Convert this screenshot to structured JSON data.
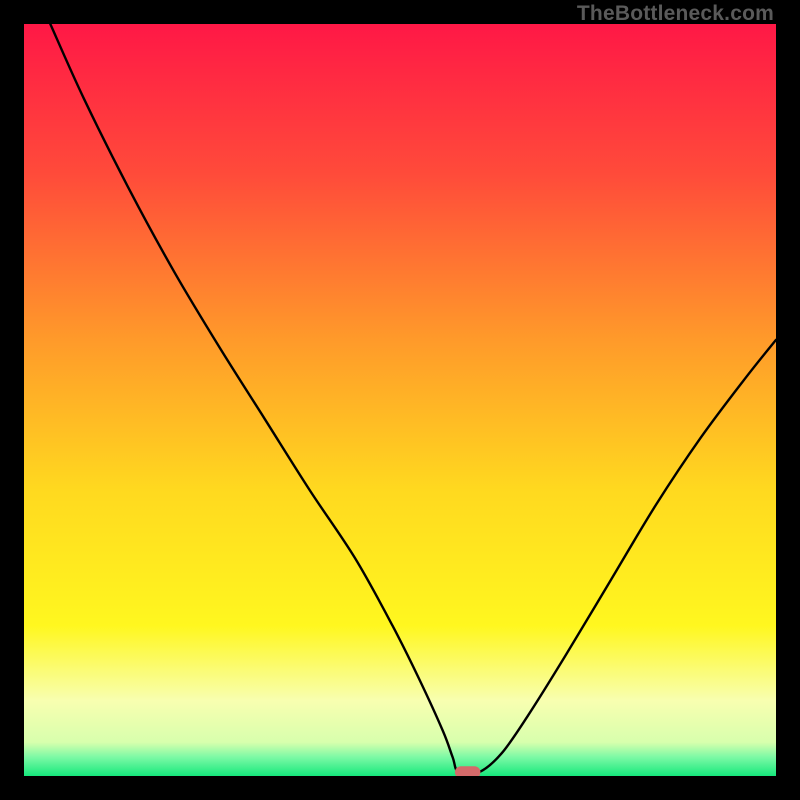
{
  "watermark": "TheBottleneck.com",
  "chart_data": {
    "type": "line",
    "title": "",
    "xlabel": "",
    "ylabel": "",
    "xlim": [
      0,
      100
    ],
    "ylim": [
      0,
      100
    ],
    "gradient_stops": [
      {
        "offset": 0.0,
        "color": "#ff1846"
      },
      {
        "offset": 0.2,
        "color": "#ff4b3a"
      },
      {
        "offset": 0.42,
        "color": "#ff9a2a"
      },
      {
        "offset": 0.62,
        "color": "#ffd91f"
      },
      {
        "offset": 0.8,
        "color": "#fff71f"
      },
      {
        "offset": 0.9,
        "color": "#f8ffb0"
      },
      {
        "offset": 0.955,
        "color": "#d8ffad"
      },
      {
        "offset": 0.975,
        "color": "#7cf9a5"
      },
      {
        "offset": 1.0,
        "color": "#16e87c"
      }
    ],
    "series": [
      {
        "name": "bottleneck-curve",
        "x": [
          3.5,
          8,
          14,
          20,
          26,
          32,
          38,
          44,
          49,
          52.5,
          55.7,
          57,
          57.8,
          60.5,
          63.5,
          67,
          72,
          78,
          84,
          90,
          96,
          100
        ],
        "y": [
          100,
          90,
          78,
          67,
          57,
          47.5,
          38,
          29,
          20,
          13,
          6,
          2.5,
          0.5,
          0.5,
          3,
          8,
          16,
          26,
          36,
          45,
          53,
          58
        ]
      }
    ],
    "marker": {
      "name": "optimum-marker",
      "x": 59.0,
      "y": 0.5,
      "width_pct": 3.4,
      "height_pct": 1.6,
      "color": "#d46a6a",
      "rx": 6
    }
  }
}
